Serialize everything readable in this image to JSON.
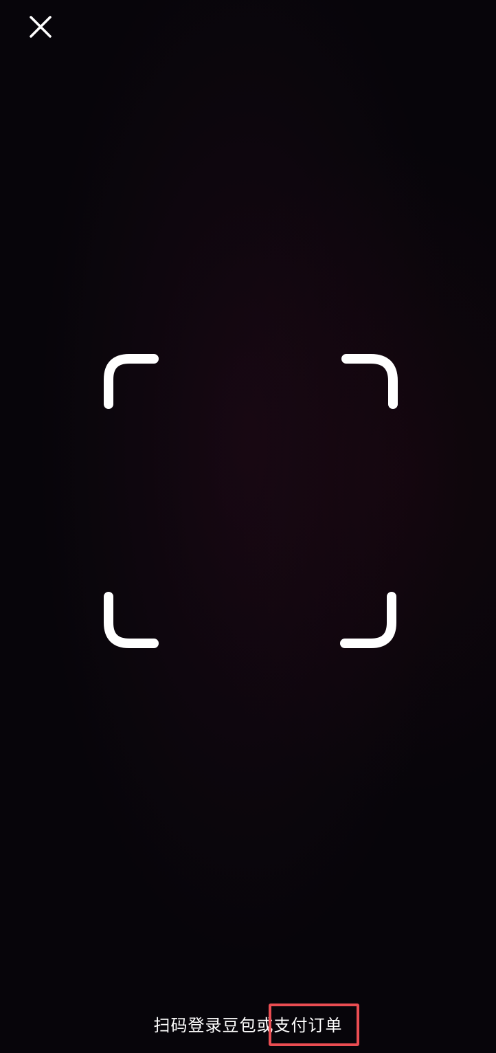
{
  "camera_view": {
    "background_color": "#07050a"
  },
  "header": {
    "close_icon": "close-icon"
  },
  "scanner": {
    "frame_icon": "scan-frame-corners-icon",
    "frame_color": "#ffffff"
  },
  "footer": {
    "hint_prefix": "扫码登录豆包或",
    "hint_highlight": "支付订单",
    "highlight_color": "#ea4d52"
  }
}
